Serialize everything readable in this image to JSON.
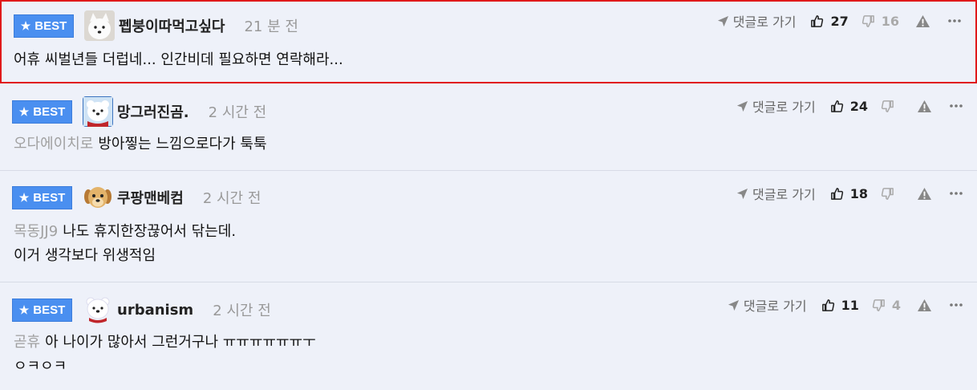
{
  "comments": [
    {
      "badge": "BEST",
      "nickname": "펩붕이따먹고싶다",
      "time": "21 분 전",
      "reply_label": "댓글로 가기",
      "likes": "27",
      "dislikes": "16",
      "mention": "",
      "text_lines": [
        "어휴 씨벌년들 더럽네... 인간비데 필요하면 연락해라..."
      ],
      "avatar": "white-dog-avatar"
    },
    {
      "badge": "BEST",
      "nickname": "망그러진곰.",
      "time": "2 시간 전",
      "reply_label": "댓글로 가기",
      "likes": "24",
      "dislikes": "",
      "mention": "오다에이치로",
      "text_lines": [
        "방아찧는 느낌으로다가 툭툭"
      ],
      "avatar": "polar-bear-avatar"
    },
    {
      "badge": "BEST",
      "nickname": "쿠팡맨베컴",
      "time": "2 시간 전",
      "reply_label": "댓글로 가기",
      "likes": "18",
      "dislikes": "",
      "mention": "목동JJ9",
      "text_lines": [
        "나도 휴지한장끊어서 닦는데.",
        "이거 생각보다 위생적임"
      ],
      "avatar": "puppy-avatar"
    },
    {
      "badge": "BEST",
      "nickname": "urbanism",
      "time": "2 시간 전",
      "reply_label": "댓글로 가기",
      "likes": "11",
      "dislikes": "4",
      "mention": "곧휴",
      "text_lines": [
        "아 나이가 많아서 그런거구나 ㅠㅠㅠㅠㅠㅠㅜ",
        "ㅇㅋㅇㅋ"
      ],
      "avatar": "polar-bear-avatar"
    }
  ],
  "colors": {
    "badge": "#4a8ff0",
    "selected_border": "#e0191b",
    "background": "#eef1f9"
  }
}
